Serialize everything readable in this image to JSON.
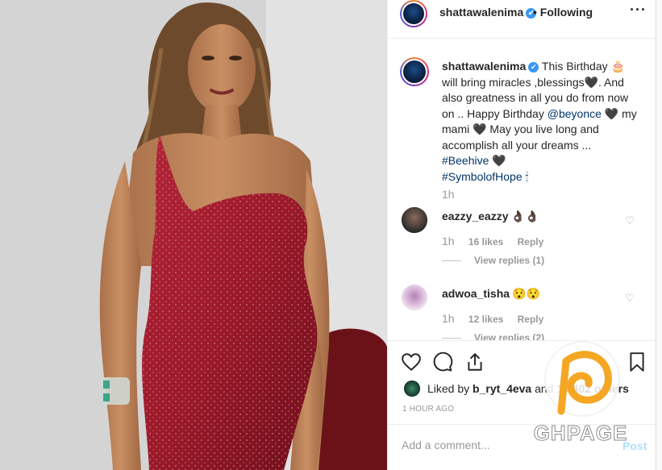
{
  "header": {
    "username": "shattawalenima",
    "verified_badge": "✔",
    "following_label": "• Following",
    "more_label": "···"
  },
  "caption": {
    "username": "shattawalenima",
    "verified_badge": "✔",
    "text_1": "This Birthday 🎂 will bring miracles ,blessings🖤. And also greatness in all you do from now on .. Happy Birthday",
    "mention": "@beyonce",
    "text_2": "🖤 my mami 🖤 May you live long and accomplish all your dreams ...",
    "hashtag_1": "#Beehive",
    "hashtag_1_suffix": "🖤",
    "hashtag_2": "#SymbolofHope",
    "hashtag_2_suffix": "🕯",
    "time": "1h"
  },
  "comments": [
    {
      "username": "eazzy_eazzy",
      "text": "👌🏿👌🏿",
      "time": "1h",
      "likes": "16 likes",
      "reply_label": "Reply",
      "view_replies": "View replies (1)"
    },
    {
      "username": "adwoa_tisha",
      "text": "😯😯",
      "time": "1h",
      "likes": "12 likes",
      "reply_label": "Reply",
      "view_replies": "View replies (2)"
    }
  ],
  "actions": {
    "icons": [
      "heart-icon",
      "comment-icon",
      "share-icon",
      "bookmark-icon"
    ]
  },
  "likes": {
    "prefix": "Liked by",
    "user": "b_ryt_4eva",
    "connector": "and",
    "others": "14,402 others"
  },
  "post_time": "1 HOUR AGO",
  "add_comment": {
    "placeholder": "Add a comment...",
    "post_label": "Post"
  },
  "watermark": {
    "text": "GHPAGE"
  },
  "colors": {
    "link": "#003569",
    "muted": "#999999",
    "verified": "#3897f0",
    "post_disabled": "#b2dffc",
    "dress": "#9c1a2a"
  }
}
